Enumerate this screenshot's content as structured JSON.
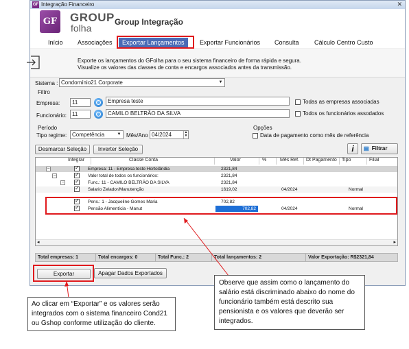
{
  "window": {
    "title": "Integração Financeiro",
    "close_glyph": "✕",
    "app_icon": "GF"
  },
  "branding": {
    "logo_glyph": "GF",
    "group": "GROUP",
    "folha": "folha",
    "app_title": "Group Integração"
  },
  "menu": {
    "items": [
      "Início",
      "Associações",
      "Exportar Lançamentos",
      "Exportar Funcionários",
      "Consulta",
      "Cálculo Centro Custo"
    ],
    "active_index": 2
  },
  "info": {
    "line1": "Exporte os lançamentos do GFolha para o seu sistema financeiro de forma rápida e segura.",
    "line2": "Visualize os valores das classes de conta e encargos associados antes da transmissão."
  },
  "sistema": {
    "label": "Sistema :",
    "value": "Condomínio21 Corporate"
  },
  "filtro": {
    "title": "Filtro",
    "empresa_label": "Empresa:",
    "empresa_code": "11",
    "empresa_name": "Empresa teste",
    "funcionario_label": "Funcionário:",
    "funcionario_code": "11",
    "funcionario_name": "CAMILO BELTRÃO DA SILVA",
    "todas_empresas": "Todas as empresas associadas",
    "todos_funcionarios": "Todos os funcionários assodados"
  },
  "periodo": {
    "title": "Período",
    "tipo_label": "Tipo regime:",
    "tipo_value": "Competência",
    "mes_label": "Mês/Ano",
    "mes_value": "04/2024"
  },
  "opcoes": {
    "title": "Opções",
    "data_pagamento": "Data de pagamento como mês de referência"
  },
  "toolbar": {
    "desmarcar": "Desmarcar Seleção",
    "inverter": "Inverter Seleção",
    "info_glyph": "i",
    "filtrar": "Filtrar"
  },
  "grid": {
    "headers": [
      "Integrar",
      "Classe Conta",
      "Valor",
      "%",
      "Mês Ref.",
      "Dt Pagamento",
      "Tipo",
      "Filial"
    ],
    "rows": [
      {
        "classe": "Empresa: 11 - Empresa teste Hortolândia",
        "valor": "2321,84",
        "mes": "",
        "tipo": "",
        "checked": true
      },
      {
        "classe": "Valor total de todos os funcionários:",
        "valor": "2321,84",
        "mes": "",
        "tipo": "",
        "checked": true
      },
      {
        "classe": "Func.: 11 - CAMILO BELTRÃO DA SILVA",
        "valor": "2321,84",
        "mes": "",
        "tipo": "",
        "checked": true
      },
      {
        "classe": "Salario Zelador/Manutenção",
        "valor": "1619,02",
        "mes": "04/2024",
        "tipo": "Normal",
        "checked": true
      },
      {
        "classe": "Pens.: 1 - Jacqueline Gomes Maria",
        "valor": "702,82",
        "mes": "",
        "tipo": "",
        "checked": true
      },
      {
        "classe": "Pensão Alimentícia - Manut",
        "valor": "702,82",
        "mes": "04/2024",
        "tipo": "Normal",
        "checked": true
      }
    ]
  },
  "status": {
    "empresas": "Total empresas: 1",
    "encargos": "Total encargos: 0",
    "func": "Total Func.: 2",
    "lancamentos": "Total lançamentos: 2",
    "valor": "Valor Exportação: R$2321,84"
  },
  "buttons": {
    "exportar": "Exportar",
    "apagar": "Apagar Dados Exportados"
  },
  "callouts": {
    "left": "Ao clicar em “Exportar” e os valores serão integrados com o sistema financeiro Cond21 ou Gshop conforme utilização do cliente.",
    "right": "Observe que assim como o lançamento do salário está discriminado abaixo do nome do funcionário também está descrito sua pensionista e os valores que deverão ser integrados."
  },
  "colors": {
    "accent": "#4a6bb6",
    "highlight": "#e0191c",
    "logo": "#7a2b86",
    "selected_cell": "#1e6fd6"
  }
}
